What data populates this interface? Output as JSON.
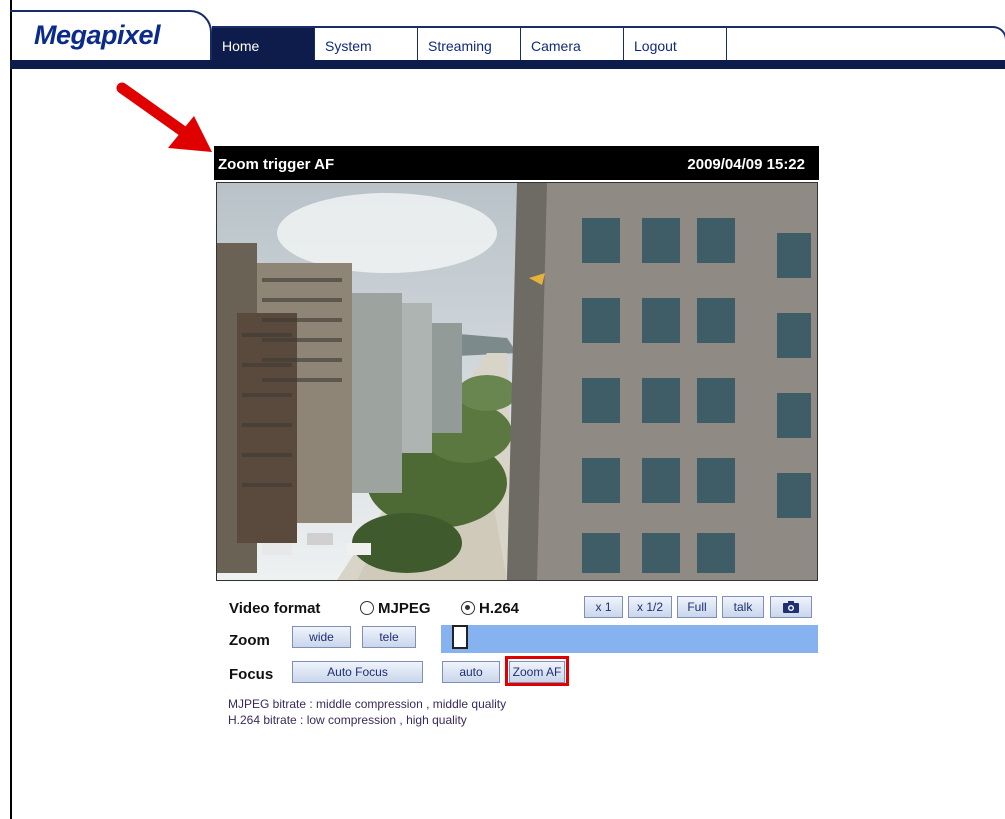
{
  "brand": {
    "logo_text": "Megapixel"
  },
  "nav": {
    "tabs": [
      {
        "label": "Home",
        "active": true
      },
      {
        "label": "System",
        "active": false
      },
      {
        "label": "Streaming",
        "active": false
      },
      {
        "label": "Camera",
        "active": false
      },
      {
        "label": "Logout",
        "active": false
      }
    ]
  },
  "video": {
    "caption": "Zoom trigger AF",
    "timestamp": "2009/04/09 15:22"
  },
  "video_format": {
    "label": "Video format",
    "options": [
      {
        "label": "MJPEG",
        "selected": false
      },
      {
        "label": "H.264",
        "selected": true
      }
    ]
  },
  "view_buttons": {
    "x1": "x 1",
    "x_half": "x 1/2",
    "full": "Full",
    "talk": "talk",
    "snapshot_icon": "camera-icon"
  },
  "zoom": {
    "label": "Zoom",
    "wide": "wide",
    "tele": "tele",
    "level": 0.03
  },
  "focus": {
    "label": "Focus",
    "auto_focus": "Auto Focus",
    "auto": "auto",
    "zoom_af": "Zoom AF"
  },
  "bitrate": {
    "mjpeg": "MJPEG bitrate : middle compression , middle quality",
    "h264": "H.264 bitrate : low compression , high quality"
  },
  "colors": {
    "nav_dark": "#0d1c4a",
    "logo": "#0a2a8c",
    "zoom_bar": "#86b2ef",
    "highlight": "#e00000",
    "arrow": "#e00000"
  }
}
